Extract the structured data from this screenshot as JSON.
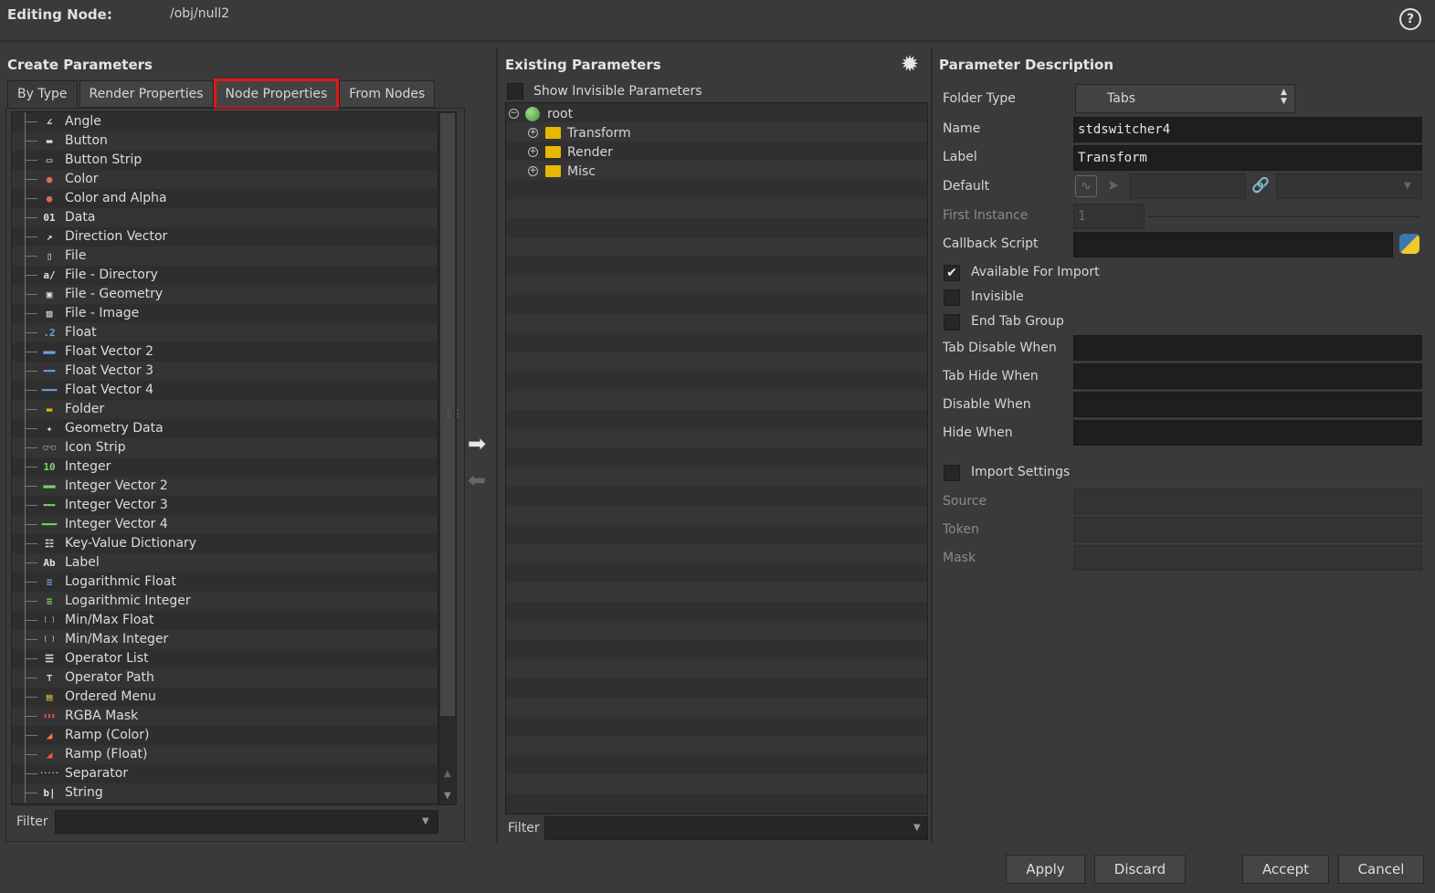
{
  "header": {
    "label": "Editing Node:",
    "path": "/obj/null2"
  },
  "create_params": {
    "title": "Create Parameters",
    "tabs": [
      "By Type",
      "Render Properties",
      "Node Properties",
      "From Nodes"
    ],
    "items": [
      {
        "label": "Angle",
        "icon": "angle-icon"
      },
      {
        "label": "Button",
        "icon": "button-icon"
      },
      {
        "label": "Button Strip",
        "icon": "button-strip-icon"
      },
      {
        "label": "Color",
        "icon": "color-icon"
      },
      {
        "label": "Color and Alpha",
        "icon": "color-alpha-icon"
      },
      {
        "label": "Data",
        "icon": "data-icon"
      },
      {
        "label": "Direction Vector",
        "icon": "direction-vector-icon"
      },
      {
        "label": "File",
        "icon": "file-icon"
      },
      {
        "label": "File - Directory",
        "icon": "directory-icon"
      },
      {
        "label": "File - Geometry",
        "icon": "file-geometry-icon"
      },
      {
        "label": "File - Image",
        "icon": "file-image-icon"
      },
      {
        "label": "Float",
        "icon": "float-icon"
      },
      {
        "label": "Float Vector 2",
        "icon": "float-vector2-icon"
      },
      {
        "label": "Float Vector 3",
        "icon": "float-vector3-icon"
      },
      {
        "label": "Float Vector 4",
        "icon": "float-vector4-icon"
      },
      {
        "label": "Folder",
        "icon": "folder-icon"
      },
      {
        "label": "Geometry Data",
        "icon": "geometry-data-icon"
      },
      {
        "label": "Icon Strip",
        "icon": "icon-strip-icon"
      },
      {
        "label": "Integer",
        "icon": "integer-icon"
      },
      {
        "label": "Integer Vector 2",
        "icon": "integer-vector2-icon"
      },
      {
        "label": "Integer Vector 3",
        "icon": "integer-vector3-icon"
      },
      {
        "label": "Integer Vector 4",
        "icon": "integer-vector4-icon"
      },
      {
        "label": "Key-Value Dictionary",
        "icon": "dictionary-icon"
      },
      {
        "label": "Label",
        "icon": "label-icon"
      },
      {
        "label": "Logarithmic Float",
        "icon": "log-float-icon"
      },
      {
        "label": "Logarithmic Integer",
        "icon": "log-integer-icon"
      },
      {
        "label": "Min/Max Float",
        "icon": "minmax-float-icon"
      },
      {
        "label": "Min/Max Integer",
        "icon": "minmax-integer-icon"
      },
      {
        "label": "Operator List",
        "icon": "operator-list-icon"
      },
      {
        "label": "Operator Path",
        "icon": "operator-path-icon"
      },
      {
        "label": "Ordered Menu",
        "icon": "ordered-menu-icon"
      },
      {
        "label": "RGBA Mask",
        "icon": "rgba-mask-icon"
      },
      {
        "label": "Ramp (Color)",
        "icon": "ramp-color-icon"
      },
      {
        "label": "Ramp (Float)",
        "icon": "ramp-float-icon"
      },
      {
        "label": "Separator",
        "icon": "separator-icon"
      },
      {
        "label": "String",
        "icon": "string-icon"
      }
    ],
    "filter_label": "Filter"
  },
  "existing_params": {
    "title": "Existing Parameters",
    "show_invisible_label": "Show Invisible Parameters",
    "root_label": "root",
    "folders": [
      "Transform",
      "Render",
      "Misc"
    ],
    "filter_label": "Filter"
  },
  "param_desc": {
    "title": "Parameter Description",
    "folder_type_label": "Folder Type",
    "folder_type_value": "Tabs",
    "name_label": "Name",
    "name_value": "stdswitcher4",
    "label_label": "Label",
    "label_value": "Transform",
    "default_label": "Default",
    "first_instance_label": "First Instance",
    "first_instance_value": "1",
    "callback_label": "Callback Script",
    "available_import_label": "Available For Import",
    "invisible_label": "Invisible",
    "end_tab_group_label": "End Tab Group",
    "tab_disable_when_label": "Tab Disable When",
    "tab_hide_when_label": "Tab Hide When",
    "disable_when_label": "Disable When",
    "hide_when_label": "Hide When",
    "import_settings_label": "Import Settings",
    "source_label": "Source",
    "token_label": "Token",
    "mask_label": "Mask"
  },
  "footer": {
    "apply": "Apply",
    "discard": "Discard",
    "accept": "Accept",
    "cancel": "Cancel"
  },
  "colors": {
    "highlight": "#e01818",
    "folder": "#e8b800",
    "background": "#3a3a3a",
    "field": "#1e1e1e"
  }
}
